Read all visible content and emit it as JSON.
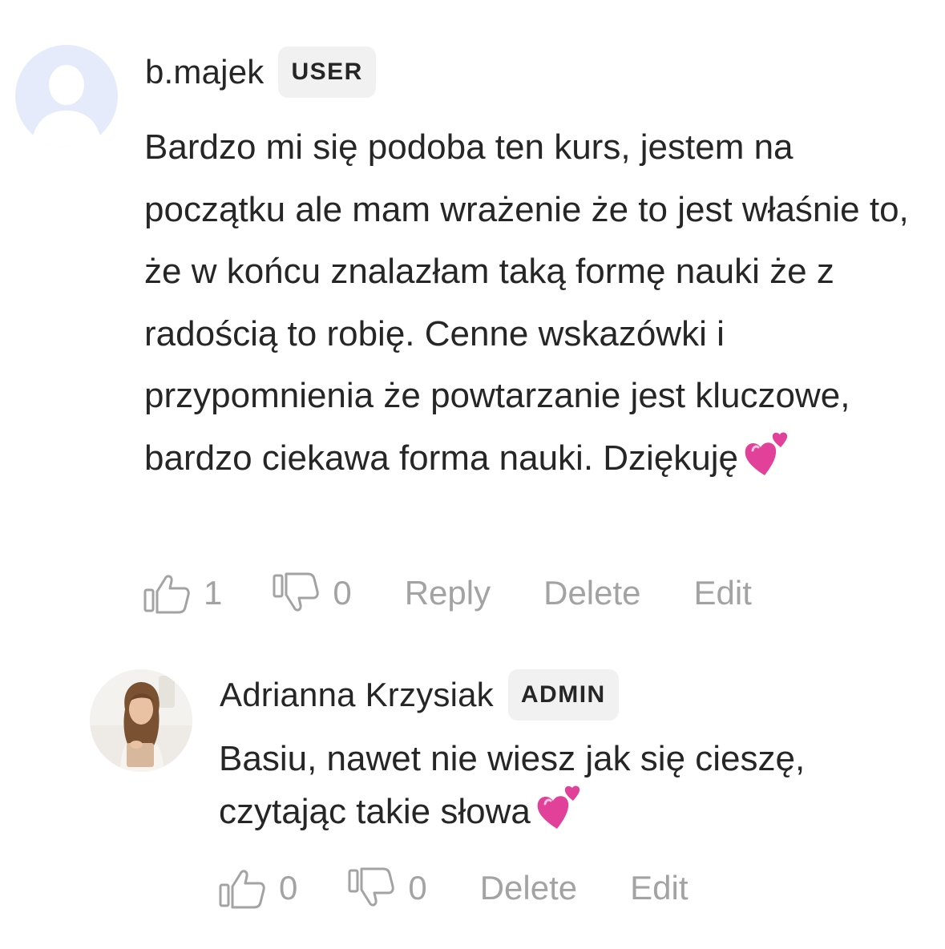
{
  "comments": [
    {
      "author": "b.majek",
      "role": "USER",
      "text": "Bardzo mi się podoba ten kurs, jestem na początku ale mam wrażenie że to jest właśnie to, że w końcu znalazłam taką formę nauki że z radością to robię. Cenne wskazówki i przypomnienia że powtarzanie jest kluczowe, bardzo ciekawa forma nauki. Dziękuję",
      "emoji": "two-hearts",
      "likes": "1",
      "dislikes": "0",
      "actions": {
        "reply": "Reply",
        "delete": "Delete",
        "edit": "Edit"
      }
    },
    {
      "author": "Adrianna Krzysiak",
      "role": "ADMIN",
      "text": "Basiu, nawet nie wiesz jak się cieszę, czytając takie słowa",
      "emoji": "two-hearts",
      "likes": "0",
      "dislikes": "0",
      "actions": {
        "delete": "Delete",
        "edit": "Edit"
      }
    }
  ],
  "colors": {
    "text": "#262626",
    "muted": "#a3a3a3",
    "badge_bg": "#f1f1f1",
    "placeholder_avatar": "#e6ebfb",
    "heart": "#e2419a"
  },
  "icons": {
    "like": "thumbs-up-icon",
    "dislike": "thumbs-down-icon",
    "default_avatar": "person-silhouette-icon"
  }
}
